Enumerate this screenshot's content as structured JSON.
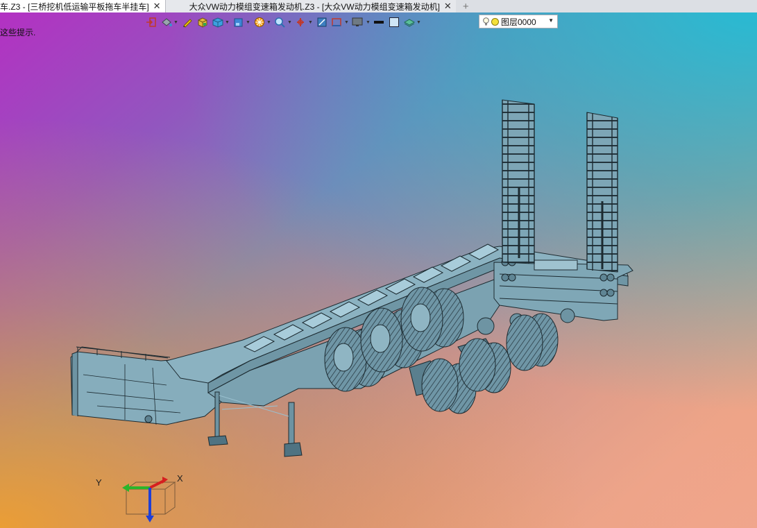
{
  "tabs": [
    {
      "label": "车.Z3 - [三桥挖机低运输平板拖车半挂车]",
      "close": "✕"
    },
    {
      "label": "大众VW动力模组变速箱发动机.Z3 - [大众VW动力模组变速箱发动机]",
      "close": "✕"
    }
  ],
  "new_tab_symbol": "+",
  "hint_text": "这些提示.",
  "layer": {
    "name": "图层0000",
    "color": "#f3e03a"
  },
  "triad": {
    "x_label": "X",
    "y_label": "Y"
  },
  "colors": {
    "model": "#7aa3b3",
    "model_edge": "#1c2a30"
  },
  "toolbar_icons": [
    "import-icon",
    "paint-bucket-icon",
    "pen-icon",
    "box-color-icon",
    "cube-icon",
    "view-cube-icon",
    "wheel-icon",
    "zoom-icon",
    "grab-icon",
    "snap-icon",
    "frame-icon",
    "display-icon",
    "line-weight-icon",
    "fill-color-icon",
    "layer-stack-icon"
  ]
}
